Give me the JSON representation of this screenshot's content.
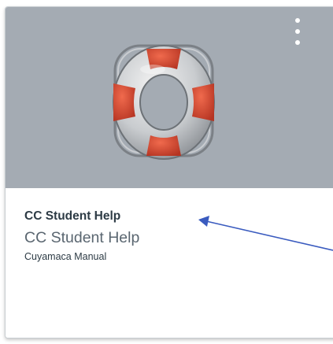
{
  "course_card": {
    "title": "CC Student Help",
    "name": "CC Student Help",
    "term": "Cuyamaca Manual",
    "hero_color": "#a4abb3",
    "image_icon": "lifebuoy-icon",
    "menu_icon": "kebab-vertical-icon"
  },
  "annotation": {
    "arrow_color": "#3a5bbf"
  }
}
